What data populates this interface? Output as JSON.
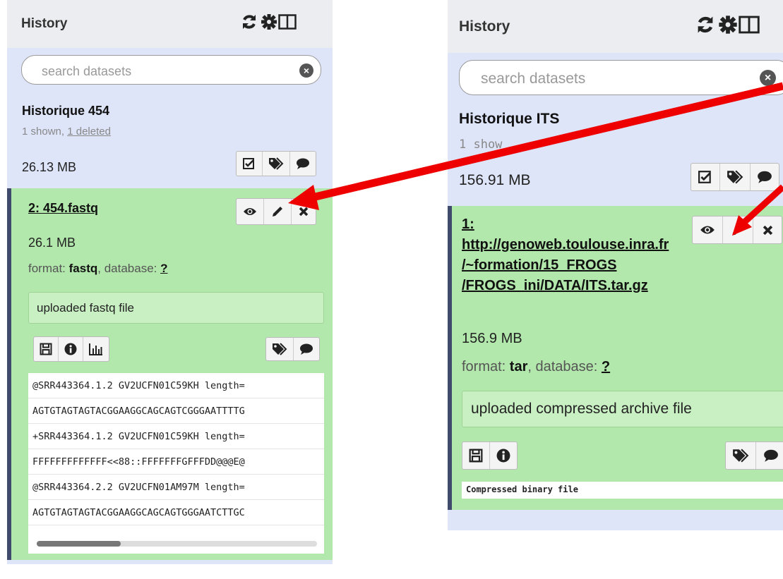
{
  "arrow_color": "#ee0000",
  "left": {
    "header": {
      "title": "History",
      "icons": [
        "refresh-icon",
        "gear-icon",
        "columns-icon"
      ]
    },
    "search": {
      "placeholder": "search datasets"
    },
    "history": {
      "name": "Historique 454",
      "shown": "1 shown, ",
      "deleted": "1 deleted",
      "size": "26.13 MB"
    },
    "dataset": {
      "title": "2: 454.fastq",
      "size": "26.1 MB",
      "format_label": "format: ",
      "format": "fastq",
      "db_label": ", database: ",
      "db": "?",
      "info": "uploaded fastq file",
      "peek": [
        "@SRR443364.1.2 GV2UCFN01C59KH length=",
        "AGTGTAGTAGTACGGAAGGCAGCAGTCGGGAATTTTG",
        "+SRR443364.1.2 GV2UCFN01C59KH length=",
        "FFFFFFFFFFFFF<<88::FFFFFFFGFFFDD@@@E@",
        "@SRR443364.2.2 GV2UCFN01AM97M length=",
        "AGTGTAGTAGTACGGAAGGCAGCAGTGGGAATCTTGC"
      ],
      "scroll_fraction": 0.3
    }
  },
  "right": {
    "header": {
      "title": "History",
      "icons": [
        "refresh-icon",
        "gear-icon",
        "columns-icon"
      ]
    },
    "search": {
      "placeholder": "search datasets"
    },
    "history": {
      "name": "Historique ITS",
      "shown": "1 show",
      "size": "156.91 MB"
    },
    "dataset": {
      "title_lines": [
        "1:",
        "http://genoweb.toulouse.inra.fr",
        "/~formation/15_FROGS",
        "/FROGS_ini/DATA/ITS.tar.gz"
      ],
      "size": "156.9 MB",
      "format_label": "format: ",
      "format": "tar",
      "db_label": ", database: ",
      "db": "?",
      "info": "uploaded compressed archive file",
      "peek": "Compressed binary file"
    }
  }
}
